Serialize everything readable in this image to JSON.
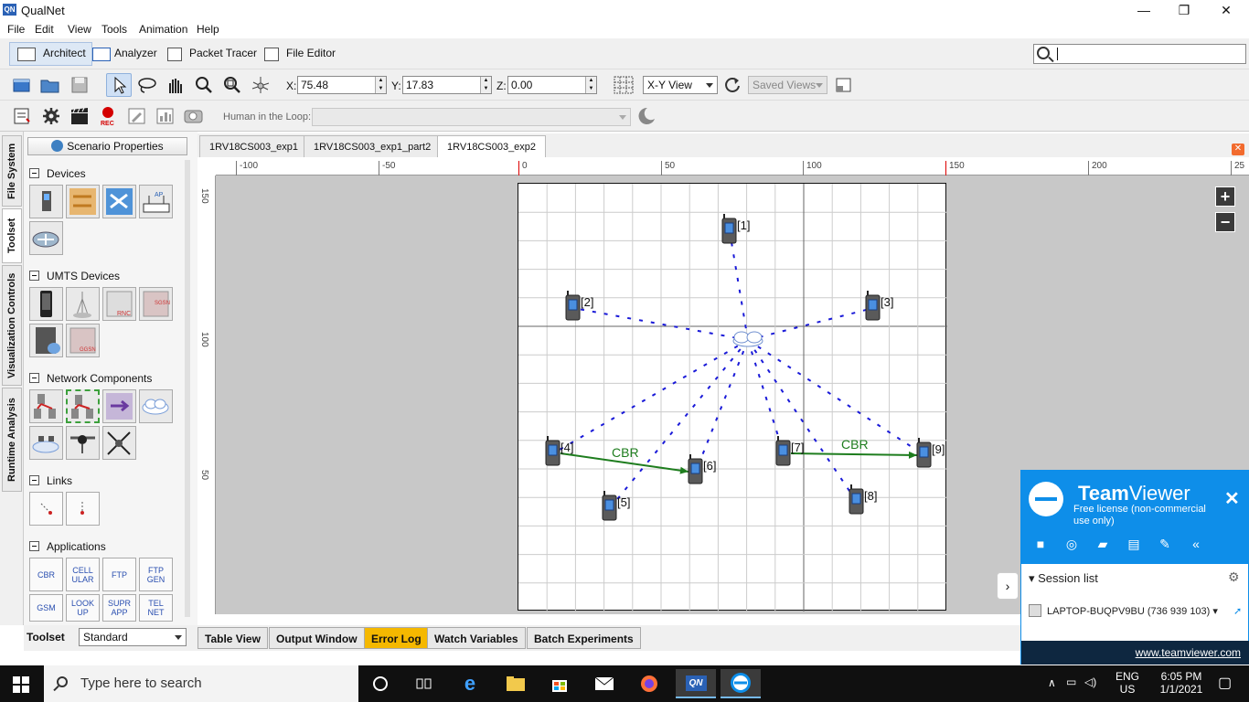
{
  "window": {
    "title": "QualNet",
    "app_icon_text": "QN",
    "controls": [
      "—",
      "❐",
      "✕"
    ]
  },
  "menu": [
    "File",
    "Edit",
    "View",
    "Tools",
    "Animation",
    "Help"
  ],
  "modes": [
    {
      "label": "Architect",
      "active": true
    },
    {
      "label": "Analyzer",
      "active": false
    },
    {
      "label": "Packet Tracer",
      "active": false
    },
    {
      "label": "File Editor",
      "active": false
    }
  ],
  "search": {
    "value": ""
  },
  "coords": {
    "x_label": "X:",
    "x": "75.48",
    "y_label": "Y:",
    "y": "17.83",
    "z_label": "Z:",
    "z": "0.00"
  },
  "view_select": "X-Y View",
  "saved_views": "Saved Views",
  "human_in_loop": "Human in the Loop:",
  "vertical_tabs": [
    "File System",
    "Toolset",
    "Visualization Controls",
    "Runtime Analysis"
  ],
  "toolset": {
    "scenario_properties": "Scenario Properties",
    "sections": {
      "devices": "Devices",
      "umts": "UMTS Devices",
      "network": "Network Components",
      "links": "Links",
      "applications": "Applications"
    },
    "apps": [
      "CBR",
      "CELL\nULAR",
      "FTP",
      "FTP\nGEN",
      "GSM",
      "LOOK\nUP",
      "SUPR\nAPP",
      "TEL\nNET"
    ],
    "toolset_label": "Toolset",
    "toolset_value": "Standard"
  },
  "file_tabs": [
    {
      "label": "1RV18CS003_exp1",
      "active": false
    },
    {
      "label": "1RV18CS003_exp1_part2",
      "active": false
    },
    {
      "label": "1RV18CS003_exp2",
      "active": true
    }
  ],
  "ruler": {
    "h_ticks": [
      "-100",
      "-50",
      "0",
      "50",
      "100",
      "150",
      "200",
      "25"
    ],
    "v_ticks": [
      "150",
      "100",
      "50"
    ]
  },
  "nodes": [
    {
      "id": "[1]"
    },
    {
      "id": "[2]"
    },
    {
      "id": "[3]"
    },
    {
      "id": "[4]"
    },
    {
      "id": "[5]"
    },
    {
      "id": "[6]"
    },
    {
      "id": "[7]"
    },
    {
      "id": "[8]"
    },
    {
      "id": "[9]"
    }
  ],
  "links": [
    {
      "from": "[4]",
      "to": "[6]",
      "label": "CBR"
    },
    {
      "from": "[7]",
      "to": "[9]",
      "label": "CBR"
    }
  ],
  "colors": {
    "wireless_link": "#1a1ad8",
    "cbr_link": "#1e7d1e",
    "error_log_tab": "#f5b800",
    "teamviewer": "#0e8ee9"
  },
  "bottom_tabs": [
    "Table View",
    "Output Window",
    "Error Log",
    "Watch Variables",
    "Batch Experiments"
  ],
  "teamviewer": {
    "name_bold": "Team",
    "name_rest": "Viewer",
    "subtitle": "Free license (non-commercial use only)",
    "session_list": "Session list",
    "device": "LAPTOP-BUQPV9BU (736 939 103)",
    "link": "www.teamviewer.com"
  },
  "taskbar": {
    "search_placeholder": "Type here to search",
    "lang": "ENG",
    "region": "US",
    "time": "6:05 PM",
    "date": "1/1/2021"
  }
}
